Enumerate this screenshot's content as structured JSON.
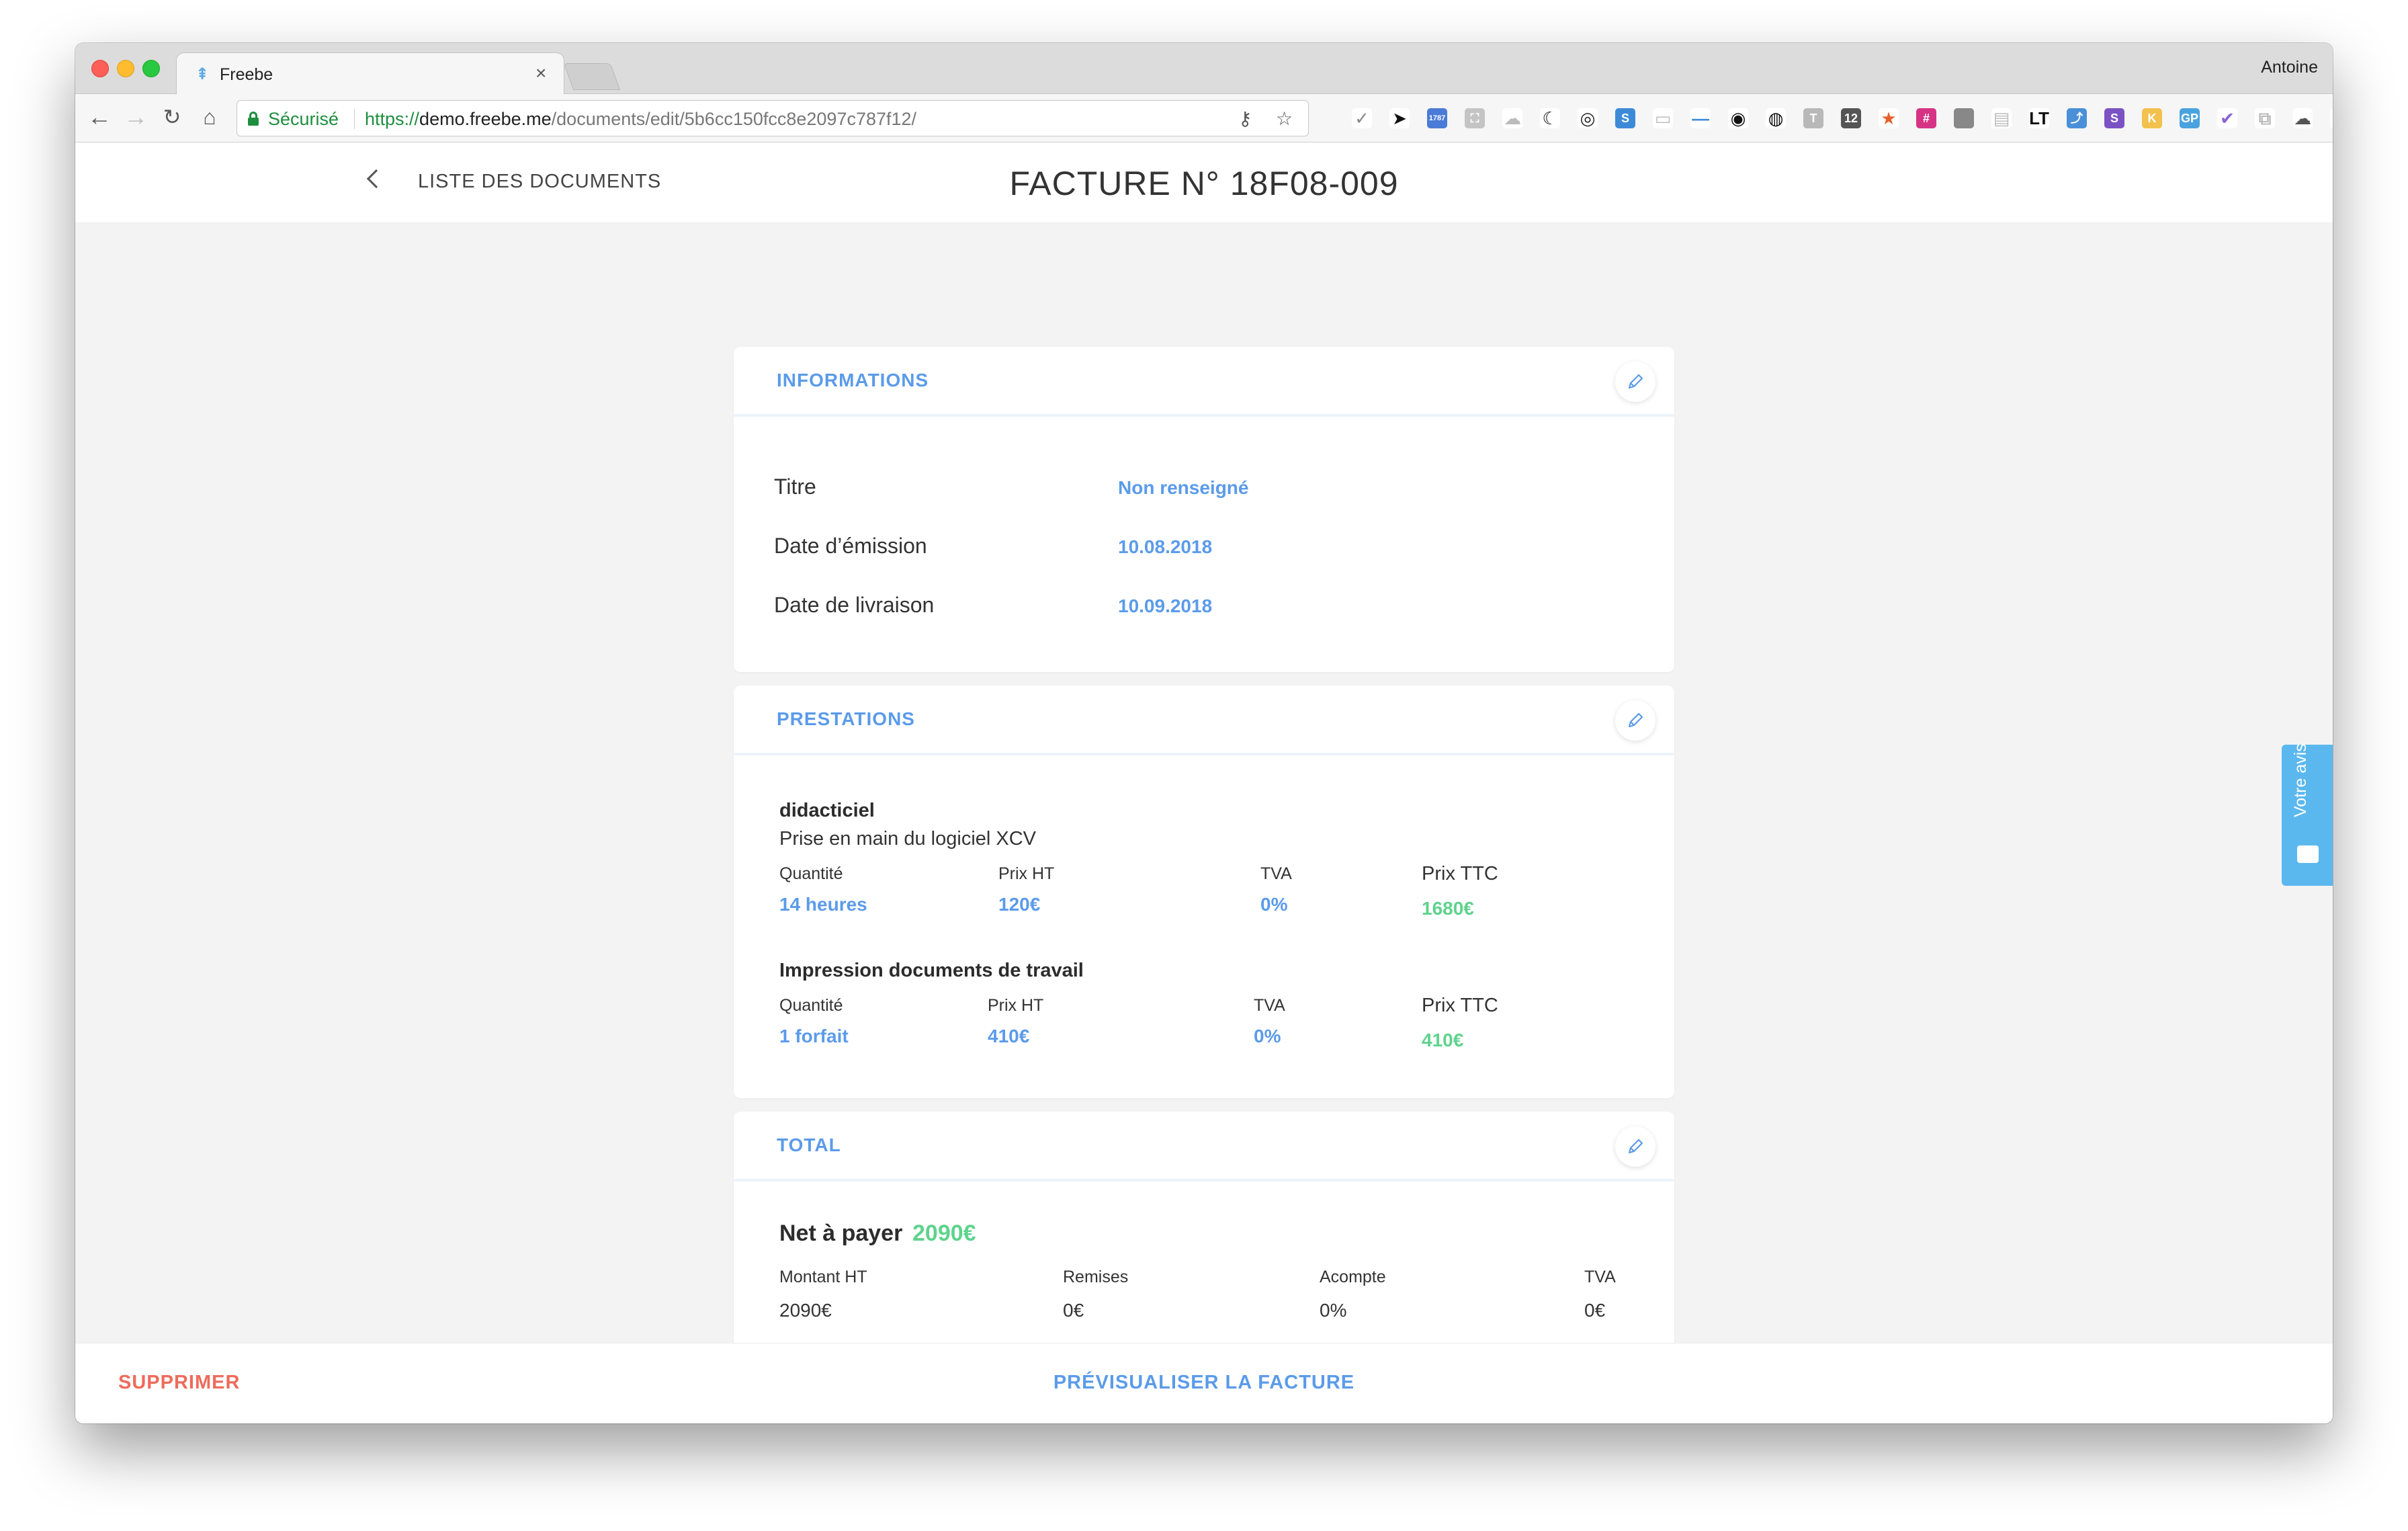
{
  "browser": {
    "tab_title": "Freebe",
    "tab_close": "×",
    "profile_name": "Antoine",
    "secure_label": "Sécurisé",
    "url_scheme": "https://",
    "url_host": "demo.freebe.me",
    "url_path": "/documents/edit/5b6cc150fcc8e2097c787f12/",
    "extensions": [
      {
        "name": "checkmark-icon",
        "color": "#ffffff",
        "glyph": "✓",
        "fg": "#888888"
      },
      {
        "name": "cursor-extension-icon",
        "color": "#ffffff",
        "glyph": "➤",
        "fg": "#111111"
      },
      {
        "name": "badge-1787-icon",
        "color": "#4a7bd6",
        "glyph": "1787",
        "fg": "#ffffff"
      },
      {
        "name": "translate-icon",
        "color": "#c4c4c4",
        "glyph": "⛶",
        "fg": "#ffffff"
      },
      {
        "name": "cloud-icon",
        "color": "#ffffff",
        "glyph": "☁",
        "fg": "#bbbbbb"
      },
      {
        "name": "moon-icon",
        "color": "#ffffff",
        "glyph": "☾",
        "fg": "#111111"
      },
      {
        "name": "spiral-icon",
        "color": "#ffffff",
        "glyph": "◎",
        "fg": "#222222"
      },
      {
        "name": "s-blue-icon",
        "color": "#3d8bd8",
        "glyph": "S",
        "fg": "#ffffff"
      },
      {
        "name": "chat-icon",
        "color": "#ffffff",
        "glyph": "▭",
        "fg": "#bbbbbb"
      },
      {
        "name": "dash-icon",
        "color": "#ffffff",
        "glyph": "—",
        "fg": "#3d8bd8"
      },
      {
        "name": "eye-icon",
        "color": "#ffffff",
        "glyph": "◉",
        "fg": "#111111"
      },
      {
        "name": "speech-icon",
        "color": "#ffffff",
        "glyph": "◍",
        "fg": "#111111"
      },
      {
        "name": "t-grey-icon",
        "color": "#b8b8b8",
        "glyph": "T",
        "fg": "#ffffff"
      },
      {
        "name": "calendar-12-icon",
        "color": "#555555",
        "glyph": "12",
        "fg": "#ffffff"
      },
      {
        "name": "star-icon",
        "color": "#ffffff",
        "glyph": "★",
        "fg": "#e8602c"
      },
      {
        "name": "hex-icon",
        "color": "#d63384",
        "glyph": "#",
        "fg": "#ffffff"
      },
      {
        "name": "grey-square-icon",
        "color": "#888888",
        "glyph": "",
        "fg": "#ffffff"
      },
      {
        "name": "page-icon",
        "color": "#ffffff",
        "glyph": "▤",
        "fg": "#bbbbbb"
      },
      {
        "name": "lt-icon",
        "color": "#ffffff",
        "glyph": "LT",
        "fg": "#111111"
      },
      {
        "name": "chart-icon",
        "color": "#4a90d9",
        "glyph": "⤴",
        "fg": "#ffffff"
      },
      {
        "name": "s-purple-icon",
        "color": "#7b52c4",
        "glyph": "S",
        "fg": "#ffffff"
      },
      {
        "name": "k-icon",
        "color": "#f2c14e",
        "glyph": "K",
        "fg": "#ffffff"
      },
      {
        "name": "gp-icon",
        "color": "#4aa3df",
        "glyph": "GP",
        "fg": "#ffffff"
      },
      {
        "name": "double-check-icon",
        "color": "#ffffff",
        "glyph": "✔",
        "fg": "#8a63d2"
      },
      {
        "name": "frame-icon",
        "color": "#ffffff",
        "glyph": "⧉",
        "fg": "#bbbbbb"
      },
      {
        "name": "cloud-badge-2-icon",
        "color": "#ffffff",
        "glyph": "☁",
        "fg": "#555555"
      },
      {
        "name": "pocket-icon",
        "color": "#ffffff",
        "glyph": "♡",
        "fg": "#e05a5a"
      },
      {
        "name": "glasses-icon",
        "color": "#ffffff",
        "glyph": "◓",
        "fg": "#111111"
      },
      {
        "name": "menu-dots-icon",
        "color": "#ffffff",
        "glyph": "⋮",
        "fg": "#444444"
      }
    ]
  },
  "header": {
    "back_label": "LISTE DES DOCUMENTS",
    "title": "FACTURE N° 18F08-009"
  },
  "informations": {
    "section_title": "INFORMATIONS",
    "rows": [
      {
        "label": "Titre",
        "value": "Non renseigné"
      },
      {
        "label": "Date d’émission",
        "value": "10.08.2018"
      },
      {
        "label": "Date de livraison",
        "value": "10.09.2018"
      }
    ]
  },
  "prestations": {
    "section_title": "PRESTATIONS",
    "items": [
      {
        "title": "didacticiel",
        "description": "Prise en main du logiciel XCV",
        "qty_label": "Quantité",
        "qty": "14 heures",
        "price_label": "Prix HT",
        "price": "120€",
        "vat_label": "TVA",
        "vat": "0%",
        "ttc_label": "Prix TTC",
        "ttc": "1680€"
      },
      {
        "title": "Impression documents de travail",
        "description": "",
        "qty_label": "Quantité",
        "qty": "1 forfait",
        "price_label": "Prix HT",
        "price": "410€",
        "vat_label": "TVA",
        "vat": "0%",
        "ttc_label": "Prix TTC",
        "ttc": "410€"
      }
    ]
  },
  "total": {
    "section_title": "TOTAL",
    "net_label": "Net à payer",
    "net_value": "2090€",
    "columns": [
      {
        "label": "Montant HT",
        "value": "2090€"
      },
      {
        "label": "Remises",
        "value": "0€"
      },
      {
        "label": "Acompte",
        "value": "0%"
      },
      {
        "label": "TVA",
        "value": "0€"
      }
    ]
  },
  "footer": {
    "delete_label": "SUPPRIMER",
    "preview_label": "PRÉVISUALISER LA FACTURE"
  },
  "feedback": {
    "label": "Votre avis"
  },
  "colors": {
    "accent_blue": "#5b9bea",
    "accent_green": "#5fd38d",
    "danger_red": "#ee6b5b",
    "feedback_blue": "#5bb8ef"
  }
}
